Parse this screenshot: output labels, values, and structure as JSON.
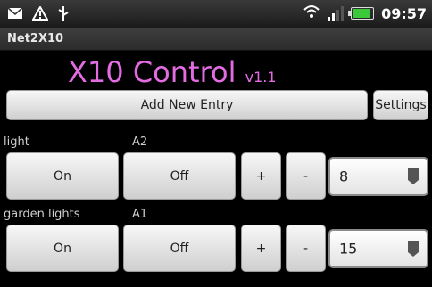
{
  "status_bar": {
    "time": "09:57",
    "icons": [
      "message-icon",
      "warning-icon",
      "usb-icon",
      "wifi-icon",
      "signal-icon",
      "battery-icon"
    ],
    "battery_color": "#39c939"
  },
  "app_title": "Net2X10",
  "header": {
    "title": "X10 Control",
    "version": "v1.1",
    "color": "#e36ce3"
  },
  "toolbar": {
    "add_label": "Add New Entry",
    "settings_label": "Settings"
  },
  "entries": [
    {
      "name": "light",
      "code": "A2",
      "on_label": "On",
      "off_label": "Off",
      "plus_label": "+",
      "minus_label": "-",
      "level": "8"
    },
    {
      "name": "garden lights",
      "code": "A1",
      "on_label": "On",
      "off_label": "Off",
      "plus_label": "+",
      "minus_label": "-",
      "level": "15"
    }
  ]
}
